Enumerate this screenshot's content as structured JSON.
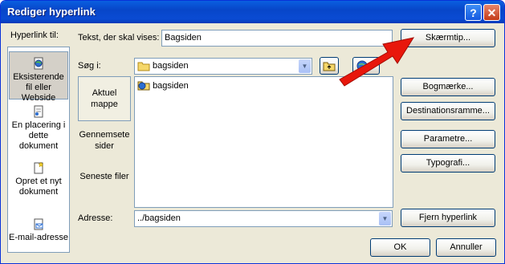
{
  "window": {
    "title": "Rediger hyperlink"
  },
  "titlebar": {
    "help_glyph": "?",
    "close_glyph": "✕"
  },
  "left": {
    "link_to_label": "Hyperlink til:",
    "items": [
      {
        "label": "Eksisterende fil eller Webside",
        "icon": "web-page-icon",
        "selected": true
      },
      {
        "label": "En placering i dette dokument",
        "icon": "document-place-icon",
        "selected": false
      },
      {
        "label": "Opret et nyt dokument",
        "icon": "new-document-icon",
        "selected": false
      },
      {
        "label": "E-mail-adresse",
        "icon": "email-icon",
        "selected": false
      }
    ]
  },
  "text_to_display": {
    "label": "Tekst, der skal vises:",
    "value": "Bagsiden"
  },
  "look_in": {
    "label": "Søg i:",
    "value": "bagsiden"
  },
  "places": [
    {
      "label": "Aktuel mappe",
      "selected": true
    },
    {
      "label": "Gennemsete sider",
      "selected": false
    },
    {
      "label": "Seneste filer",
      "selected": false
    }
  ],
  "files": [
    {
      "name": "bagsiden",
      "icon": "web-folder-icon"
    }
  ],
  "address": {
    "label": "Adresse:",
    "value": "../bagsiden"
  },
  "buttons": {
    "screentip": "Skærmtip...",
    "bookmark": "Bogmærke...",
    "target_frame": "Destinationsramme...",
    "parameters": "Parametre...",
    "style": "Typografi...",
    "remove_link": "Fjern hyperlink",
    "ok": "OK",
    "cancel": "Annuller"
  },
  "colors": {
    "titlebar": "#0a4bd3",
    "dialog_bg": "#ece9d8",
    "arrow": "#e8170c"
  }
}
